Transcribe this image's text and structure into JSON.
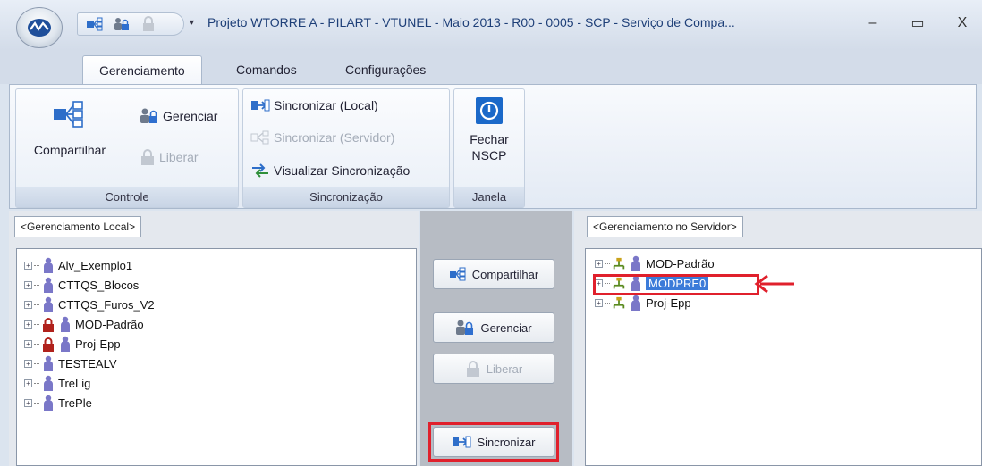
{
  "window": {
    "title": "Projeto WTORRE A - PILART - VTUNEL - Maio 2013 - R00 - 0005 - SCP - Serviço de Compa...",
    "qat_dropdown": "▾",
    "min_glyph": "–",
    "max_glyph": "▭",
    "close_glyph": "X"
  },
  "ribbon": {
    "tabs": [
      "Gerenciamento",
      "Comandos",
      "Configurações"
    ],
    "groups": {
      "controle": {
        "label": "Controle",
        "compartilhar": "Compartilhar",
        "gerenciar": "Gerenciar",
        "liberar": "Liberar"
      },
      "sincronizacao": {
        "label": "Sincronização",
        "sync_local": "Sincronizar (Local)",
        "sync_servidor": "Sincronizar (Servidor)",
        "visualizar": "Visualizar Sincronização"
      },
      "janela": {
        "label": "Janela",
        "fechar_line1": "Fechar",
        "fechar_line2": "NSCP"
      }
    }
  },
  "local_panel": {
    "tab": "<Gerenciamento Local>",
    "items": [
      {
        "label": "Alv_Exemplo1",
        "locked": false
      },
      {
        "label": "CTTQS_Blocos",
        "locked": false
      },
      {
        "label": "CTTQS_Furos_V2",
        "locked": false
      },
      {
        "label": "MOD-Padrão",
        "locked": true
      },
      {
        "label": "Proj-Epp",
        "locked": true
      },
      {
        "label": "TESTEALV",
        "locked": false
      },
      {
        "label": "TreLig",
        "locked": false
      },
      {
        "label": "TrePle",
        "locked": false
      }
    ]
  },
  "middle_panel": {
    "compartilhar": "Compartilhar",
    "gerenciar": "Gerenciar",
    "liberar": "Liberar",
    "sincronizar": "Sincronizar"
  },
  "server_panel": {
    "tab": "<Gerenciamento no Servidor>",
    "items": [
      {
        "label": "MOD-Padrão",
        "selected": false
      },
      {
        "label": "MODPRE0",
        "selected": true
      },
      {
        "label": "Proj-Epp",
        "selected": false
      }
    ]
  },
  "colors": {
    "highlight": "#e0202c",
    "selection": "#3b7bd9",
    "person_icon": "#7a77c8",
    "lock_icon": "#b0221c"
  }
}
